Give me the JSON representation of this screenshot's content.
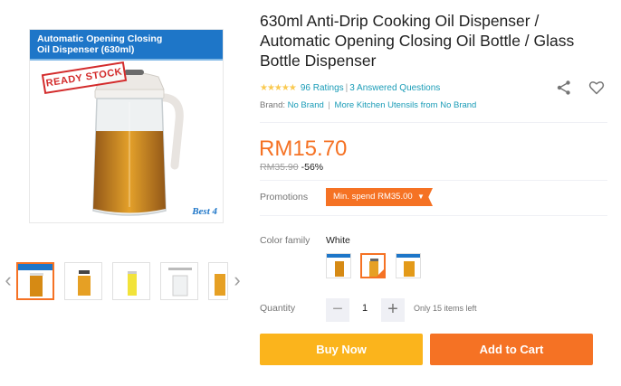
{
  "gallery": {
    "banner_line1": "Automatic Opening Closing",
    "banner_line2": "Oil Dispenser (630ml)",
    "stamp": "READY STOCK",
    "logo": "Best 4",
    "prev_icon": "chevron-left-icon",
    "next_icon": "chevron-right-icon",
    "thumbnail_count": 5
  },
  "product": {
    "title": "630ml Anti-Drip Cooking Oil Dispenser / Automatic Opening Closing Oil Bottle / Glass Bottle Dispenser",
    "rating_stars": "★★★★★",
    "ratings": "96 Ratings",
    "questions": "3 Answered Questions",
    "brand_label": "Brand:",
    "brand": "No Brand",
    "more_link": "More Kitchen Utensils from No Brand",
    "share_icon": "share-icon",
    "wishlist_icon": "heart-icon"
  },
  "pricing": {
    "price": "RM15.70",
    "original_price": "RM35.90",
    "discount": "-56%",
    "price_color": "#f57224"
  },
  "promotions": {
    "label": "Promotions",
    "tag": "Min. spend RM35.00"
  },
  "color_family": {
    "label": "Color family",
    "selected": "White",
    "options_count": 3
  },
  "quantity": {
    "label": "Quantity",
    "value": "1",
    "minus": "−",
    "plus": "+",
    "stock_note": "Only 15 items left"
  },
  "actions": {
    "buy_now": "Buy Now",
    "add_to_cart": "Add to Cart",
    "buy_color": "#fbb41c",
    "cart_color": "#f57224"
  }
}
